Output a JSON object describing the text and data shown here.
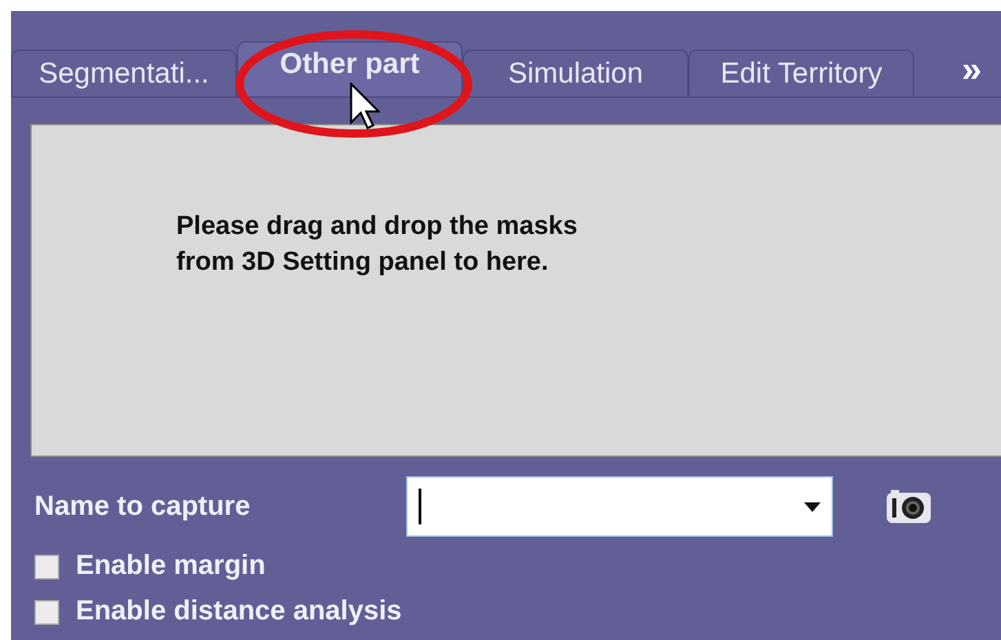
{
  "tabs": [
    {
      "label": "Segmentati...",
      "selected": false
    },
    {
      "label": "Other part",
      "selected": true
    },
    {
      "label": "Simulation",
      "selected": false
    },
    {
      "label": "Edit Territory",
      "selected": false
    }
  ],
  "more_tabs": "»",
  "drop_message": "Please drag and drop the masks\nfrom 3D Setting panel to here.",
  "capture": {
    "label": "Name to capture"
  },
  "options": [
    {
      "label": "Enable margin",
      "checked": false
    },
    {
      "label": "Enable distance analysis",
      "checked": false
    }
  ]
}
